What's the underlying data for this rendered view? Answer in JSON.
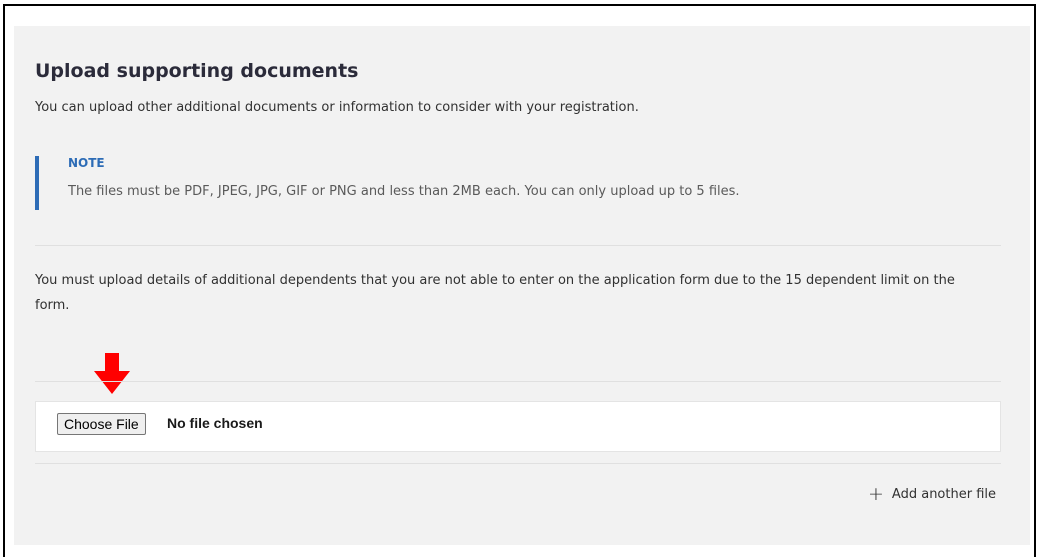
{
  "section": {
    "title": "Upload supporting documents",
    "intro": "You can upload other additional documents or information to consider with your registration."
  },
  "note": {
    "heading": "NOTE",
    "text": "The files must be PDF, JPEG, JPG, GIF or PNG and less than 2MB each. You can only upload up to 5 files."
  },
  "dependents_text": "You must upload details of additional dependents that you are not able to enter on the application form due to the 15 dependent limit on the form.",
  "file_input": {
    "button_label": "Choose File",
    "status": "No file chosen"
  },
  "add_file": {
    "icon": "plus-icon",
    "label": "Add another file"
  },
  "colors": {
    "accent": "#2d6cb6",
    "arrow": "#ff0000",
    "panel_bg": "#f2f2f2"
  }
}
